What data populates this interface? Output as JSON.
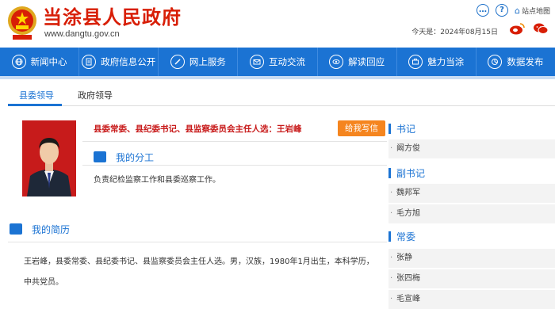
{
  "header": {
    "site_name": "当涂县人民政府",
    "site_url": "www.dangtu.gov.cn",
    "date_label": "今天是：2024年08月15日",
    "sitemap_label": "站点地图"
  },
  "nav": {
    "items": [
      {
        "label": "新闻中心",
        "icon": "globe-icon"
      },
      {
        "label": "政府信息公开",
        "icon": "document-icon"
      },
      {
        "label": "网上服务",
        "icon": "pen-icon"
      },
      {
        "label": "互动交流",
        "icon": "mail-icon"
      },
      {
        "label": "解读回应",
        "icon": "eye-icon"
      },
      {
        "label": "魅力当涂",
        "icon": "briefcase-icon"
      },
      {
        "label": "数据发布",
        "icon": "chart-icon"
      }
    ]
  },
  "tabs": [
    {
      "label": "县委领导",
      "active": true
    },
    {
      "label": "政府领导",
      "active": false
    }
  ],
  "profile": {
    "title": "县委常委、县纪委书记、县监察委员会主任人选：王岩峰",
    "write_button": "给我写信",
    "duty_heading": "我的分工",
    "duty_text": "负责纪检监察工作和县委巡察工作。",
    "resume_heading": "我的简历",
    "resume_text": "王岩峰，县委常委、县纪委书记、县监察委员会主任人选。男，汉族，1980年1月出生，本科学历，中共党员。"
  },
  "sidebar": {
    "groups": [
      {
        "heading": "书记",
        "members": [
          "阚方俊"
        ]
      },
      {
        "heading": "副书记",
        "members": [
          "魏邦军",
          "毛方旭"
        ]
      },
      {
        "heading": "常委",
        "members": [
          "张静",
          "张四梅",
          "毛宣峰"
        ]
      }
    ]
  },
  "colors": {
    "brand_blue": "#1b73d3",
    "title_red": "#d81e06",
    "button_orange": "#f5851f"
  }
}
